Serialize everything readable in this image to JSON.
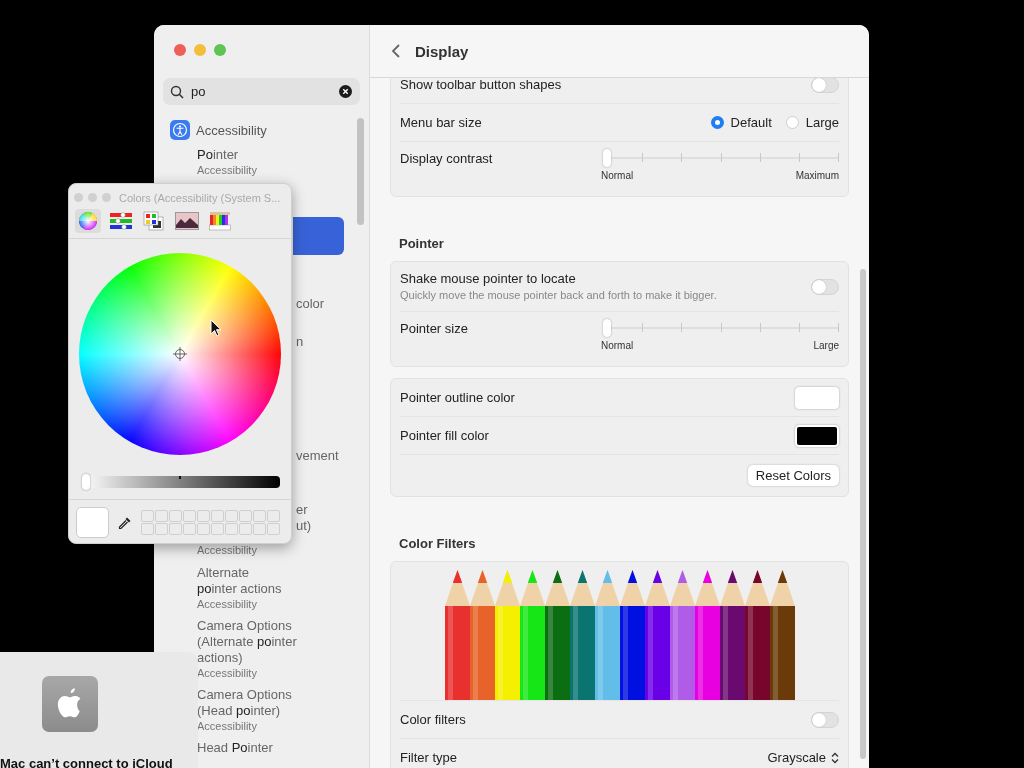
{
  "settings_window": {
    "title": "Display",
    "search": {
      "value": "po"
    },
    "sidebar": {
      "header": {
        "label": "Accessibility"
      },
      "results_top": [
        {
          "title": "**Po**inter",
          "subtitle": "Accessibility",
          "selected": false
        }
      ],
      "covered_items": [
        {
          "kind": "highlight",
          "selected": true
        },
        {
          "kind": "fragment",
          "text": "color"
        },
        {
          "kind": "fragment",
          "text": "n"
        },
        {
          "kind": "fragment",
          "text": "vement"
        },
        {
          "kind": "fragment",
          "text": "er"
        },
        {
          "kind": "fragment",
          "text": "ut)"
        },
        {
          "kind": "subtitle",
          "text": "Accessibility"
        }
      ],
      "results_bottom": [
        {
          "title": "Alternate\n**po**inter actions",
          "subtitle": "Accessibility",
          "selected": false
        },
        {
          "title": "Camera Options\n(Alternate **po**inter\nactions)",
          "subtitle": "Accessibility",
          "selected": false
        },
        {
          "title": "Camera Options\n(Head **po**inter)",
          "subtitle": "Accessibility",
          "selected": false
        },
        {
          "title": "Head **Po**inter",
          "selected": false
        }
      ]
    },
    "sections": [
      {
        "rows": [
          {
            "kind": "toggle",
            "label": "Show toolbar button shapes",
            "on": false
          },
          {
            "kind": "radio",
            "label": "Menu bar size",
            "options": [
              {
                "label": "Default",
                "selected": true
              },
              {
                "label": "Large",
                "selected": false
              }
            ]
          },
          {
            "kind": "slider",
            "label": "Display contrast",
            "level": 0,
            "min_label": "Normal",
            "max_label": "Maximum"
          }
        ]
      },
      {
        "heading": "Pointer",
        "rows": [
          {
            "kind": "toggle",
            "label": "Shake mouse pointer to locate",
            "description": "Quickly move the mouse pointer back and forth to make it bigger.",
            "on": false
          },
          {
            "kind": "slider",
            "label": "Pointer size",
            "level": 0,
            "min_label": "Normal",
            "max_label": "Large"
          }
        ]
      },
      {
        "rows": [
          {
            "kind": "color",
            "label": "Pointer outline color",
            "color": "#ffffff"
          },
          {
            "kind": "color",
            "label": "Pointer fill color",
            "color": "#000000"
          },
          {
            "kind": "button",
            "label": "Reset Colors"
          }
        ]
      },
      {
        "heading": "Color Filters",
        "rows": [
          {
            "kind": "illustration"
          },
          {
            "kind": "toggle",
            "label": "Color filters",
            "on": false
          },
          {
            "kind": "popup",
            "label": "Filter type",
            "value": "Grayscale"
          }
        ]
      }
    ]
  },
  "colors_panel": {
    "title": "Colors (Accessibility (System S...",
    "modes": [
      {
        "kind": "wheel",
        "selected": true
      },
      {
        "kind": "sliders",
        "selected": false
      },
      {
        "kind": "palettes",
        "selected": false
      },
      {
        "kind": "image",
        "selected": false
      },
      {
        "kind": "pencils",
        "selected": false
      }
    ],
    "brightness": {
      "level": 0
    }
  },
  "notification": {
    "title": "Mac can’t connect to iCloud"
  }
}
